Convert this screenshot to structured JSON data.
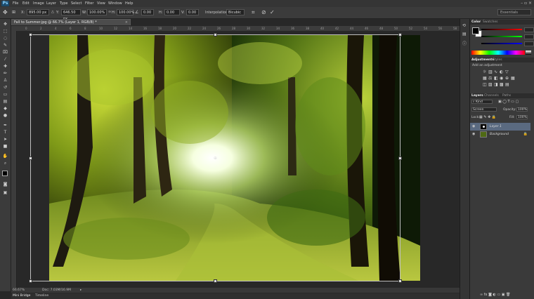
{
  "app": {
    "logo": "Ps",
    "window_controls": "– ▫ ×"
  },
  "menu": [
    "File",
    "Edit",
    "Image",
    "Layer",
    "Type",
    "Select",
    "Filter",
    "View",
    "Window",
    "Help"
  ],
  "options": {
    "x_label": "X:",
    "x_value": "895.00 px",
    "y_label": "Y:",
    "y_value": "646.50 px",
    "w_label": "W:",
    "w_value": "100.00%",
    "h_label": "H:",
    "h_value": "100.00%",
    "angle_value": "0.00",
    "hskew_label": "H:",
    "hskew_value": "0.00",
    "vskew_label": "V:",
    "vskew_value": "0.00",
    "interp_label": "Interpolation:",
    "interp_value": "Bicubic",
    "workspace": "Essentials"
  },
  "document": {
    "tab_title": "Fall to Summer.jpg @ 66.7% (Layer 1, RGB/8) *",
    "ruler_ticks": [
      "0",
      "2",
      "4",
      "6",
      "8",
      "10",
      "12",
      "14",
      "16",
      "18",
      "20",
      "22",
      "24",
      "26",
      "28",
      "30",
      "32",
      "34",
      "36",
      "38",
      "40",
      "42",
      "44",
      "46",
      "48",
      "50",
      "52",
      "54",
      "56",
      "58"
    ],
    "zoom": "66.67%",
    "doc_size": "Doc: 7.03M/16.9M"
  },
  "bottom_tabs": [
    "Mini Bridge",
    "Timeline"
  ],
  "panels": {
    "color_tabs": [
      "Color",
      "Swatches"
    ],
    "adjust_tabs": [
      "Adjustments",
      "Styles"
    ],
    "add_adjustment": "Add an adjustment",
    "layers_tabs": [
      "Layers",
      "Channels",
      "Paths"
    ],
    "kind_label": "Kind",
    "blend_mode": "Screen",
    "opacity_label": "Opacity:",
    "opacity_value": "100%",
    "lock_label": "Lock:",
    "fill_label": "Fill:",
    "fill_value": "100%",
    "layers": [
      {
        "name": "Layer 1"
      },
      {
        "name": "Background"
      }
    ]
  }
}
